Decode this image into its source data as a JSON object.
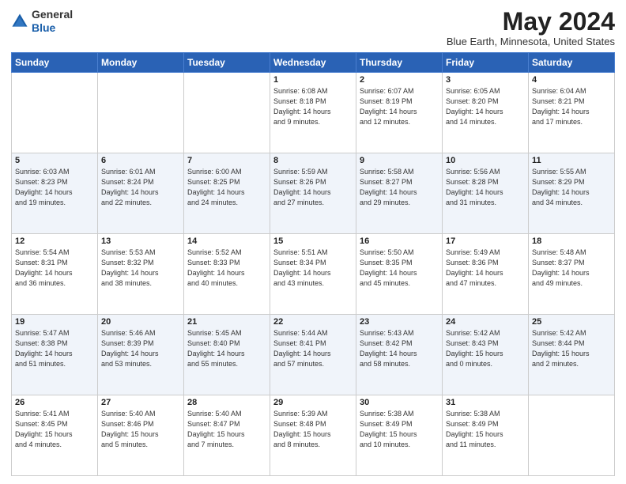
{
  "header": {
    "logo_general": "General",
    "logo_blue": "Blue",
    "month_title": "May 2024",
    "location": "Blue Earth, Minnesota, United States"
  },
  "weekdays": [
    "Sunday",
    "Monday",
    "Tuesday",
    "Wednesday",
    "Thursday",
    "Friday",
    "Saturday"
  ],
  "weeks": [
    [
      {
        "day": "",
        "info": ""
      },
      {
        "day": "",
        "info": ""
      },
      {
        "day": "",
        "info": ""
      },
      {
        "day": "1",
        "info": "Sunrise: 6:08 AM\nSunset: 8:18 PM\nDaylight: 14 hours\nand 9 minutes."
      },
      {
        "day": "2",
        "info": "Sunrise: 6:07 AM\nSunset: 8:19 PM\nDaylight: 14 hours\nand 12 minutes."
      },
      {
        "day": "3",
        "info": "Sunrise: 6:05 AM\nSunset: 8:20 PM\nDaylight: 14 hours\nand 14 minutes."
      },
      {
        "day": "4",
        "info": "Sunrise: 6:04 AM\nSunset: 8:21 PM\nDaylight: 14 hours\nand 17 minutes."
      }
    ],
    [
      {
        "day": "5",
        "info": "Sunrise: 6:03 AM\nSunset: 8:23 PM\nDaylight: 14 hours\nand 19 minutes."
      },
      {
        "day": "6",
        "info": "Sunrise: 6:01 AM\nSunset: 8:24 PM\nDaylight: 14 hours\nand 22 minutes."
      },
      {
        "day": "7",
        "info": "Sunrise: 6:00 AM\nSunset: 8:25 PM\nDaylight: 14 hours\nand 24 minutes."
      },
      {
        "day": "8",
        "info": "Sunrise: 5:59 AM\nSunset: 8:26 PM\nDaylight: 14 hours\nand 27 minutes."
      },
      {
        "day": "9",
        "info": "Sunrise: 5:58 AM\nSunset: 8:27 PM\nDaylight: 14 hours\nand 29 minutes."
      },
      {
        "day": "10",
        "info": "Sunrise: 5:56 AM\nSunset: 8:28 PM\nDaylight: 14 hours\nand 31 minutes."
      },
      {
        "day": "11",
        "info": "Sunrise: 5:55 AM\nSunset: 8:29 PM\nDaylight: 14 hours\nand 34 minutes."
      }
    ],
    [
      {
        "day": "12",
        "info": "Sunrise: 5:54 AM\nSunset: 8:31 PM\nDaylight: 14 hours\nand 36 minutes."
      },
      {
        "day": "13",
        "info": "Sunrise: 5:53 AM\nSunset: 8:32 PM\nDaylight: 14 hours\nand 38 minutes."
      },
      {
        "day": "14",
        "info": "Sunrise: 5:52 AM\nSunset: 8:33 PM\nDaylight: 14 hours\nand 40 minutes."
      },
      {
        "day": "15",
        "info": "Sunrise: 5:51 AM\nSunset: 8:34 PM\nDaylight: 14 hours\nand 43 minutes."
      },
      {
        "day": "16",
        "info": "Sunrise: 5:50 AM\nSunset: 8:35 PM\nDaylight: 14 hours\nand 45 minutes."
      },
      {
        "day": "17",
        "info": "Sunrise: 5:49 AM\nSunset: 8:36 PM\nDaylight: 14 hours\nand 47 minutes."
      },
      {
        "day": "18",
        "info": "Sunrise: 5:48 AM\nSunset: 8:37 PM\nDaylight: 14 hours\nand 49 minutes."
      }
    ],
    [
      {
        "day": "19",
        "info": "Sunrise: 5:47 AM\nSunset: 8:38 PM\nDaylight: 14 hours\nand 51 minutes."
      },
      {
        "day": "20",
        "info": "Sunrise: 5:46 AM\nSunset: 8:39 PM\nDaylight: 14 hours\nand 53 minutes."
      },
      {
        "day": "21",
        "info": "Sunrise: 5:45 AM\nSunset: 8:40 PM\nDaylight: 14 hours\nand 55 minutes."
      },
      {
        "day": "22",
        "info": "Sunrise: 5:44 AM\nSunset: 8:41 PM\nDaylight: 14 hours\nand 57 minutes."
      },
      {
        "day": "23",
        "info": "Sunrise: 5:43 AM\nSunset: 8:42 PM\nDaylight: 14 hours\nand 58 minutes."
      },
      {
        "day": "24",
        "info": "Sunrise: 5:42 AM\nSunset: 8:43 PM\nDaylight: 15 hours\nand 0 minutes."
      },
      {
        "day": "25",
        "info": "Sunrise: 5:42 AM\nSunset: 8:44 PM\nDaylight: 15 hours\nand 2 minutes."
      }
    ],
    [
      {
        "day": "26",
        "info": "Sunrise: 5:41 AM\nSunset: 8:45 PM\nDaylight: 15 hours\nand 4 minutes."
      },
      {
        "day": "27",
        "info": "Sunrise: 5:40 AM\nSunset: 8:46 PM\nDaylight: 15 hours\nand 5 minutes."
      },
      {
        "day": "28",
        "info": "Sunrise: 5:40 AM\nSunset: 8:47 PM\nDaylight: 15 hours\nand 7 minutes."
      },
      {
        "day": "29",
        "info": "Sunrise: 5:39 AM\nSunset: 8:48 PM\nDaylight: 15 hours\nand 8 minutes."
      },
      {
        "day": "30",
        "info": "Sunrise: 5:38 AM\nSunset: 8:49 PM\nDaylight: 15 hours\nand 10 minutes."
      },
      {
        "day": "31",
        "info": "Sunrise: 5:38 AM\nSunset: 8:49 PM\nDaylight: 15 hours\nand 11 minutes."
      },
      {
        "day": "",
        "info": ""
      }
    ]
  ]
}
